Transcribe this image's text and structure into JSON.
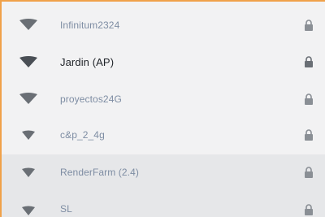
{
  "networks": [
    {
      "ssid": "Infinitum2324",
      "secured": true,
      "icon": "wifi-signal-icon",
      "lock_icon": "lock-icon"
    },
    {
      "ssid": "Jardin (AP)",
      "secured": true,
      "icon": "wifi-signal-icon",
      "lock_icon": "lock-icon"
    },
    {
      "ssid": "proyectos24G",
      "secured": true,
      "icon": "wifi-signal-icon",
      "lock_icon": "lock-icon"
    },
    {
      "ssid": "c&p_2_4g",
      "secured": true,
      "icon": "wifi-signal-icon",
      "lock_icon": "lock-icon"
    },
    {
      "ssid": "RenderFarm (2.4)",
      "secured": true,
      "icon": "wifi-signal-icon",
      "lock_icon": "lock-icon"
    },
    {
      "ssid": "SL",
      "secured": true,
      "icon": "wifi-signal-icon",
      "lock_icon": "lock-icon"
    }
  ],
  "colors": {
    "accent_border": "#f0a14a",
    "active_text": "#1f2328",
    "muted_text": "#7e8da3",
    "wifi_dark": "#4a4f55",
    "wifi_muted": "#6a6f75"
  }
}
